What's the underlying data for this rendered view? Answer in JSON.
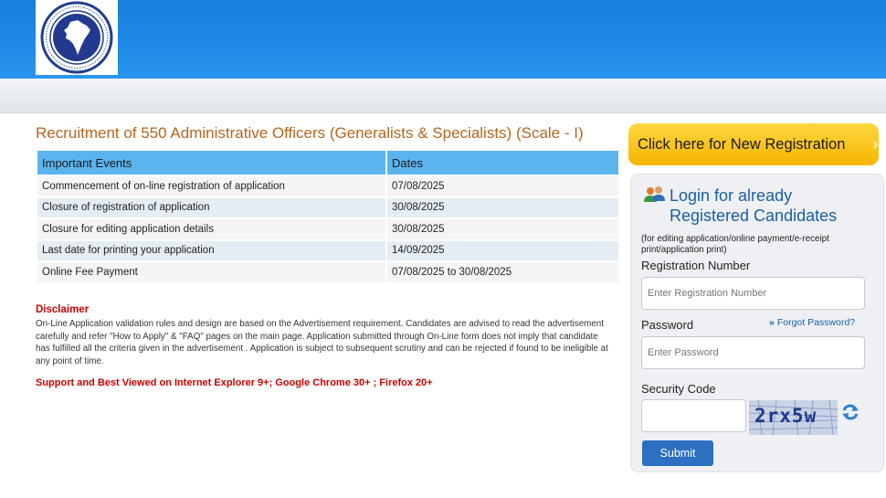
{
  "page": {
    "title": "Recruitment of 550 Administrative Officers (Generalists & Specialists) (Scale - I)"
  },
  "events_table": {
    "headers": [
      "Important Events",
      "Dates"
    ],
    "rows": [
      [
        "Commencement of on-line registration of application",
        "07/08/2025"
      ],
      [
        "Closure of registration of application",
        "30/08/2025"
      ],
      [
        "Closure for editing application details",
        "30/08/2025"
      ],
      [
        "Last date for printing your application",
        "14/09/2025"
      ],
      [
        "Online Fee Payment",
        "07/08/2025 to 30/08/2025"
      ]
    ]
  },
  "disclaimer": {
    "title": "Disclaimer",
    "text": "On-Line Application validation rules and design are based on the Advertisement requirement. Candidates are advised to read the advertisement carefully and refer \"How to Apply\" & \"FAQ\" pages on the main page. Application submitted through On-Line form does not imply that candidate has fulfilled all the criteria given in the advertisement . Application is subject to subsequent scrutiny and can be rejected if found to be ineligible at any point of time."
  },
  "support_note": "Support and Best Viewed on Internet Explorer 9+; Google Chrome 30+ ; Firefox 20+",
  "registration": {
    "label": "Click here for New Registration"
  },
  "login": {
    "title_line1": "Login for already",
    "title_line2": "Registered Candidates",
    "note": "(for editing application/online payment/e-receipt print/application print)",
    "reg_label": "Registration Number",
    "reg_placeholder": "Enter Registration Number",
    "pwd_label": "Password",
    "forgot": "Forgot Password?",
    "pwd_placeholder": "Enter Password",
    "sec_label": "Security Code",
    "captcha": "2rx5w",
    "submit": "Submit"
  },
  "colors": {
    "header_blue": "#1e8ae6",
    "title_orange": "#b5651d",
    "table_header": "#5bb4ee",
    "disclaimer_red": "#cc0000",
    "reg_button_yellow": "#f6b500",
    "link_blue": "#1a5fa6",
    "submit_blue": "#2d6fc0"
  },
  "icons": [
    "company-logo-icon",
    "double-chevron-right-icon",
    "users-icon",
    "refresh-icon"
  ]
}
